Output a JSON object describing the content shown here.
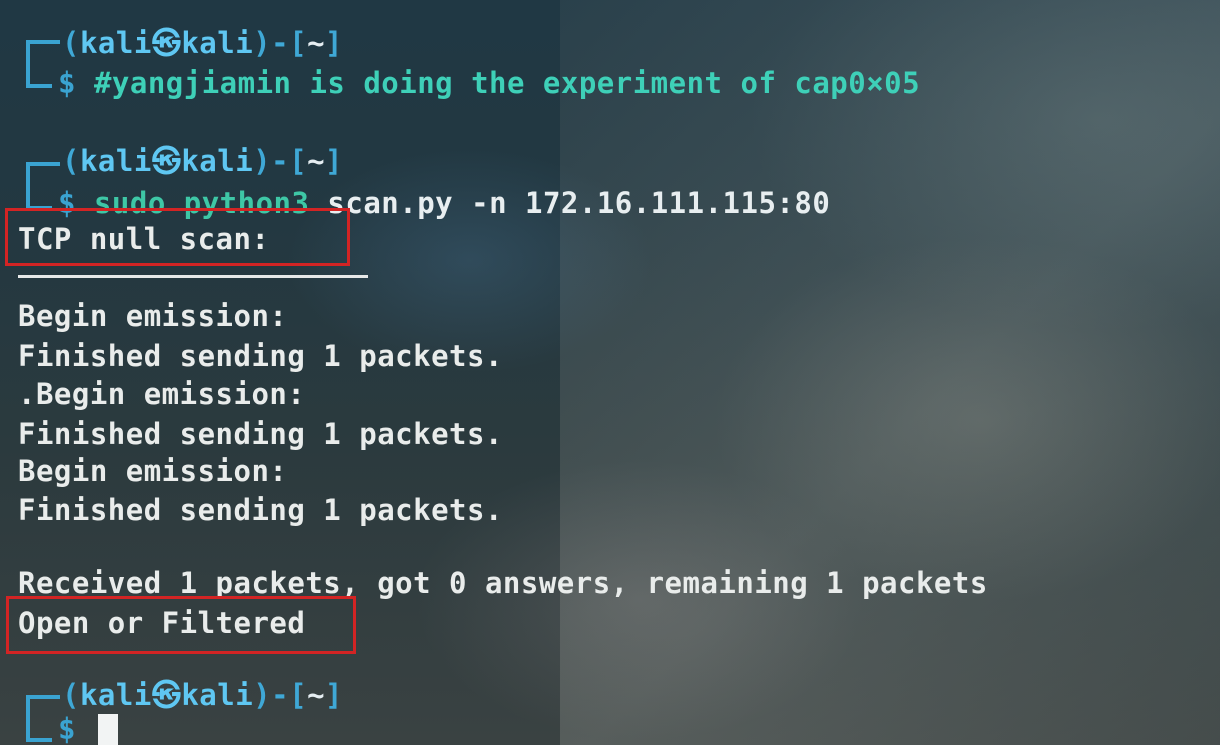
{
  "terminal": {
    "prompts": [
      {
        "user": "kali",
        "host": "kali",
        "at_symbol": "㉿",
        "dir": "~",
        "command": "#yangjiamin is doing the experiment of cap0×05"
      },
      {
        "user": "kali",
        "host": "kali",
        "at_symbol": "㉿",
        "dir": "~",
        "command_program": "sudo python3",
        "command_script": "scan.py",
        "command_flag": "-n",
        "command_target": "172.16.111.115:80"
      },
      {
        "user": "kali",
        "host": "kali",
        "at_symbol": "㉿",
        "dir": "~"
      }
    ],
    "dollar": "$",
    "scan_title": "TCP null scan:",
    "output_lines": [
      "Begin emission:",
      "Finished sending 1 packets.",
      ".Begin emission:",
      "Finished sending 1 packets.",
      "Begin emission:",
      "Finished sending 1 packets.",
      "",
      "Received 1 packets, got 0 answers, remaining 1 packets"
    ],
    "result": "Open or Filtered"
  },
  "colors": {
    "highlight_box": "#d32424",
    "prompt_blue": "#5fc7f2",
    "command_green": "#3ec7a6"
  }
}
